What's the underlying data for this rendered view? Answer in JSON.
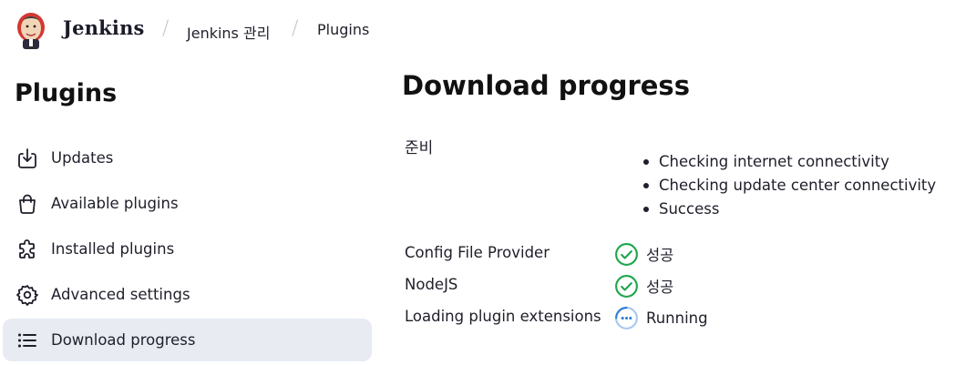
{
  "header": {
    "brand": "Jenkins",
    "breadcrumb": [
      "Jenkins 관리",
      "Plugins"
    ],
    "separator": "/"
  },
  "sidebar": {
    "title": "Plugins",
    "items": [
      {
        "label": "Updates",
        "icon": "download-icon",
        "active": false
      },
      {
        "label": "Available plugins",
        "icon": "shopping-bag-icon",
        "active": false
      },
      {
        "label": "Installed plugins",
        "icon": "puzzle-icon",
        "active": false
      },
      {
        "label": "Advanced settings",
        "icon": "gear-icon",
        "active": false
      },
      {
        "label": "Download progress",
        "icon": "list-icon",
        "active": true
      }
    ]
  },
  "main": {
    "title": "Download progress",
    "preparation": {
      "label": "준비",
      "checks": [
        "Checking internet connectivity",
        "Checking update center connectivity",
        "Success"
      ]
    },
    "jobs": [
      {
        "name": "Config File Provider",
        "status": "성공",
        "status_icon": "success-check-icon"
      },
      {
        "name": "NodeJS",
        "status": "성공",
        "status_icon": "success-check-icon"
      },
      {
        "name": "Loading plugin extensions",
        "status": "Running",
        "status_icon": "running-dots-icon"
      }
    ]
  },
  "colors": {
    "success": "#1ea64b",
    "running": "#2f7dd6",
    "active_bg": "#e8ebf2",
    "text": "#1f1f2b"
  }
}
